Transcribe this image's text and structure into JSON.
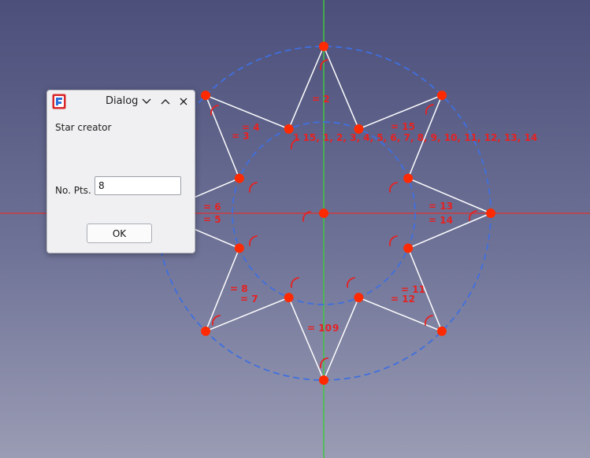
{
  "dialog": {
    "title": "Dialog",
    "app_icon": "freecad-icon",
    "heading": "Star creator",
    "points_label": "No. Pts.",
    "points_value": "8",
    "ok_label": "OK",
    "controls": [
      "chevron-down-icon",
      "chevron-up-icon",
      "close-icon"
    ]
  },
  "sketch": {
    "colors": {
      "point": "#ff2a00",
      "edge": "#ffffff",
      "construction": "#3f6fe0",
      "axis_h": "#e03030",
      "axis_v": "#3ec83e",
      "constraint": "#e52222"
    },
    "points_count": 16,
    "labels": [
      {
        "id": "c2",
        "text": "= 2"
      },
      {
        "id": "c4",
        "text": "= 4"
      },
      {
        "id": "c3",
        "text": "= 3"
      },
      {
        "id": "c15",
        "text": "= 15"
      },
      {
        "id": "clist",
        "text": "1 15, 1, 2, 3, 4, 5, 6, 7, 8, 9, 10, 11, 12, 13, 14"
      },
      {
        "id": "c6",
        "text": "= 6"
      },
      {
        "id": "c5",
        "text": "= 5"
      },
      {
        "id": "c13",
        "text": "= 13"
      },
      {
        "id": "c14",
        "text": "= 14"
      },
      {
        "id": "c8",
        "text": "= 8"
      },
      {
        "id": "c7",
        "text": "= 7"
      },
      {
        "id": "c11",
        "text": "= 11"
      },
      {
        "id": "c12",
        "text": "= 12"
      },
      {
        "id": "c10",
        "text": "= 10"
      },
      {
        "id": "c9",
        "text": "9"
      }
    ]
  }
}
